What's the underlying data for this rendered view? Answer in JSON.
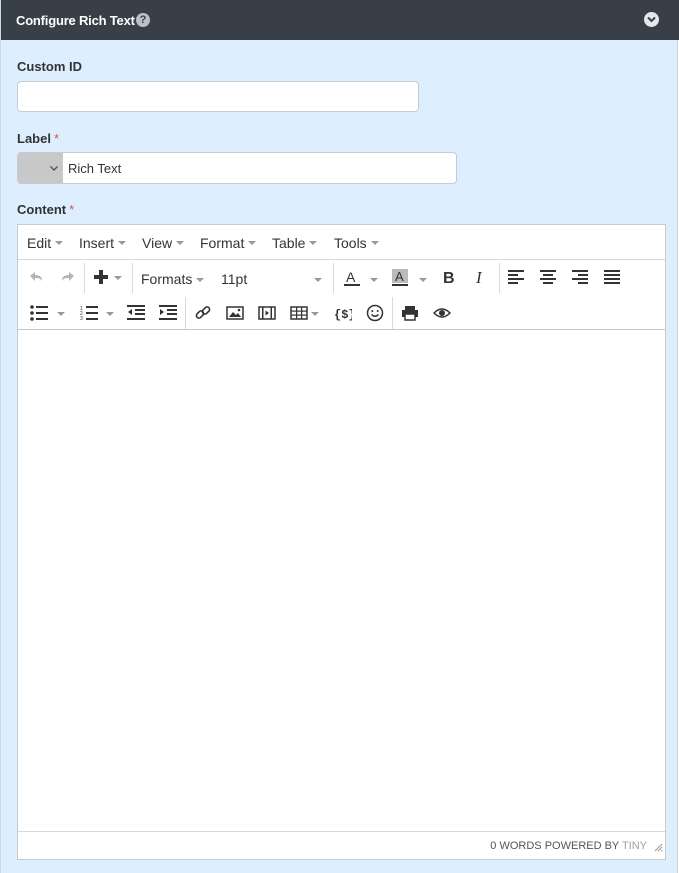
{
  "header": {
    "title": "Configure Rich Text",
    "help_icon": "question-circle-icon",
    "collapse_icon": "chevron-down-circle-icon"
  },
  "custom_id": {
    "label": "Custom ID",
    "value": "",
    "placeholder": ""
  },
  "label_field": {
    "label": "Label",
    "required_mark": "*",
    "value": "Rich Text"
  },
  "content_field": {
    "label": "Content",
    "required_mark": "*"
  },
  "editor": {
    "menu": [
      "Edit",
      "Insert",
      "View",
      "Format",
      "Table",
      "Tools"
    ],
    "formats_label": "Formats",
    "font_size": "11pt",
    "statusbar": {
      "words": "0 WORDS",
      "powered_by": "POWERED BY",
      "brand": "TINY"
    }
  },
  "colors": {
    "header_bg": "#383f47",
    "panel_bg": "#ddeeff",
    "required": "#d9534f"
  }
}
